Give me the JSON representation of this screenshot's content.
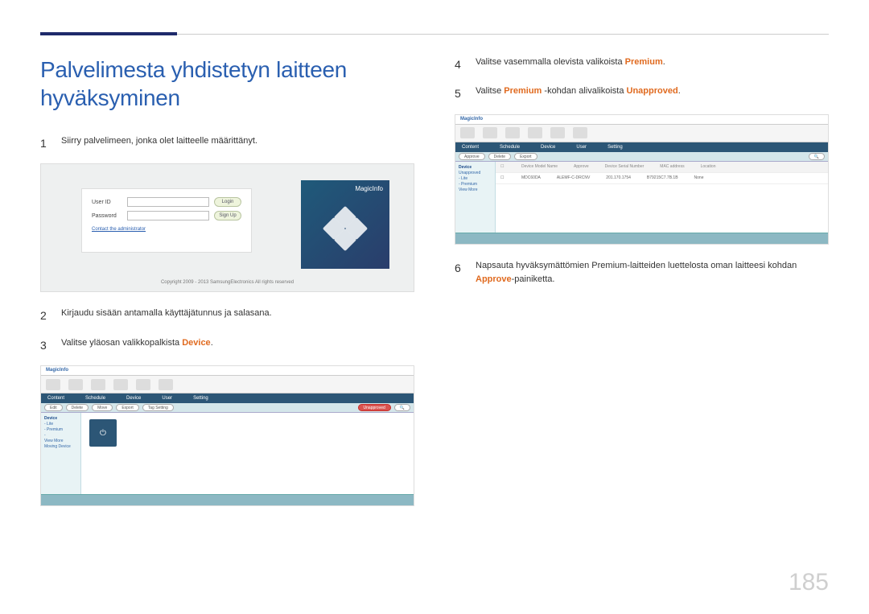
{
  "page_number": "185",
  "heading": "Palvelimesta yhdistetyn laitteen hyväksyminen",
  "steps": {
    "s1": {
      "n": "1",
      "text": "Siirry palvelimeen, jonka olet laitteelle määrittänyt."
    },
    "s2": {
      "n": "2",
      "text": "Kirjaudu sisään antamalla käyttäjätunnus ja salasana."
    },
    "s3": {
      "n": "3",
      "pre": "Valitse yläosan valikkopalkista ",
      "kw": "Device",
      "post": "."
    },
    "s4": {
      "n": "4",
      "pre": "Valitse vasemmalla olevista valikoista ",
      "kw": "Premium",
      "post": "."
    },
    "s5": {
      "n": "5",
      "pre": "Valitse ",
      "kw1": "Premium",
      "mid": " -kohdan alivalikoista ",
      "kw2": "Unapproved",
      "post": "."
    },
    "s6": {
      "n": "6",
      "pre": "Napsauta hyväksymättömien Premium-laitteiden luettelosta oman laitteesi kohdan ",
      "kw": "Approve",
      "post": "-painiketta."
    }
  },
  "shot1": {
    "userid_label": "User ID",
    "password_label": "Password",
    "login_btn": "Login",
    "signup_btn": "Sign Up",
    "contact_link": "Contact the administrator",
    "brand": "MagicInfo",
    "copyright": "Copyright 2009 - 2013 SamsungElectronics All rights reserved"
  },
  "shot_app": {
    "brand": "MagicInfo",
    "toolbar": [
      "Content",
      "Schedule",
      "Device",
      "User",
      "Setting"
    ],
    "subbar_btns": [
      "Edit",
      "Delete",
      "Move",
      "Export",
      "Tag Setting"
    ],
    "subbar_unapproved": "Unapproved",
    "side_items_2": [
      "Device",
      "- Lite",
      "- Premium",
      "-",
      "View More",
      "Moving Device"
    ],
    "side_items_3": [
      "Device",
      "Unapproved",
      "- Lite",
      "- Premium",
      "View More"
    ],
    "list_head": [
      "",
      "Device Model Name",
      "Approve",
      "Device Serial Number",
      "MAC address",
      "Location"
    ],
    "list_row": [
      "",
      "MDC60DA",
      "ALEMF-C-DRCNV",
      "201.170.1754",
      "B79215C7.7B.1B",
      "None"
    ]
  }
}
